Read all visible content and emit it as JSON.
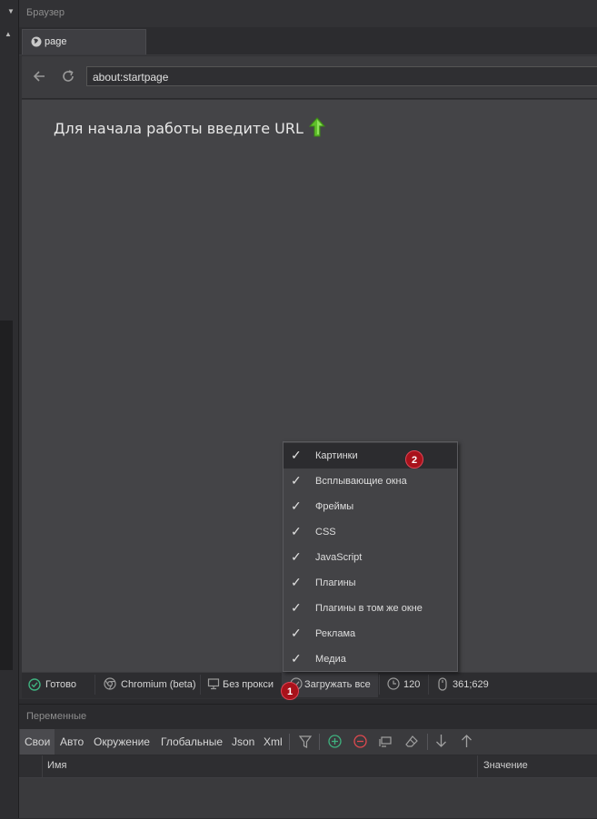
{
  "browser": {
    "panel_title": "Браузер",
    "tab_label": "page",
    "address": "about:startpage",
    "start_message": "Для начала работы введите URL"
  },
  "statusbar": {
    "ready": "Готово",
    "engine": "Chromium (beta)",
    "proxy": "Без прокси",
    "load_all": "Загружать все",
    "timeout": "120",
    "coords": "361;629"
  },
  "dropdown": {
    "items": [
      {
        "label": "Картинки",
        "checked": true
      },
      {
        "label": "Всплывающие окна",
        "checked": true
      },
      {
        "label": "Фреймы",
        "checked": true
      },
      {
        "label": "CSS",
        "checked": true
      },
      {
        "label": "JavaScript",
        "checked": true
      },
      {
        "label": "Плагины",
        "checked": true
      },
      {
        "label": "Плагины в том же окне",
        "checked": true
      },
      {
        "label": "Реклама",
        "checked": true
      },
      {
        "label": "Медиа",
        "checked": true
      }
    ]
  },
  "badges": {
    "one": "1",
    "two": "2"
  },
  "variables": {
    "panel_title": "Переменные",
    "tabs": [
      "Свои",
      "Авто",
      "Окружение",
      "Глобальные",
      "Json",
      "Xml"
    ],
    "columns": {
      "name": "Имя",
      "value": "Значение"
    }
  },
  "colors": {
    "accent_green": "#5fbf2a",
    "badge_red": "#a8121b"
  }
}
